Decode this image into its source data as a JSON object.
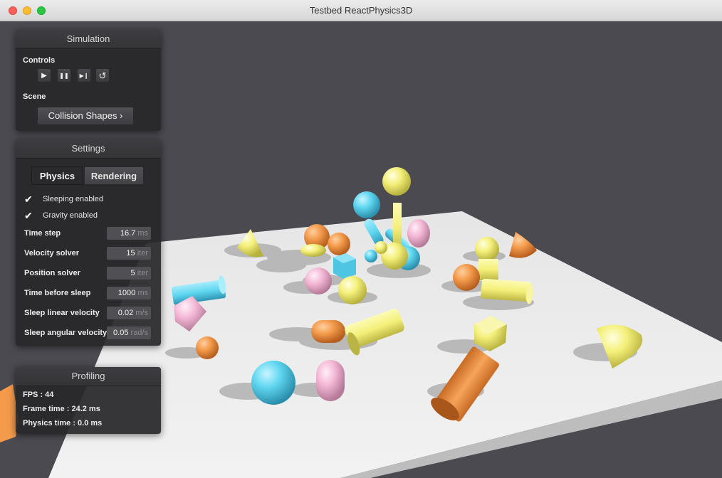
{
  "window": {
    "title": "Testbed ReactPhysics3D"
  },
  "simulation": {
    "header": "Simulation",
    "controls_label": "Controls",
    "buttons": [
      {
        "icon": "play-icon",
        "glyph": "▶"
      },
      {
        "icon": "pause-icon",
        "glyph": "❚❚"
      },
      {
        "icon": "step-icon",
        "glyph": "▶❙"
      },
      {
        "icon": "restart-icon",
        "glyph": "↺"
      }
    ],
    "scene_label": "Scene",
    "scene_button": "Collision Shapes ›"
  },
  "settings": {
    "header": "Settings",
    "tabs": {
      "physics": "Physics",
      "rendering": "Rendering"
    },
    "sleeping": "Sleeping enabled",
    "gravity": "Gravity enabled",
    "check_glyph": "✔",
    "rows": [
      {
        "label": "Time step",
        "value": "16.7",
        "unit": "ms"
      },
      {
        "label": "Velocity solver",
        "value": "15",
        "unit": "iter"
      },
      {
        "label": "Position solver",
        "value": "5",
        "unit": "iter"
      },
      {
        "label": "Time before sleep",
        "value": "1000",
        "unit": "ms"
      },
      {
        "label": "Sleep linear velocity",
        "value": "0.02",
        "unit": "m/s"
      },
      {
        "label": "Sleep angular velocity",
        "value": "0.05",
        "unit": "rad/s"
      }
    ]
  },
  "profiling": {
    "header": "Profiling",
    "fps": "FPS : 44",
    "frame_time": "Frame time : 24.2 ms",
    "physics_time": "Physics time : 0.0 ms"
  },
  "colors": {
    "background": "#4a4a50",
    "floor": "#ececec",
    "orange": "#f39a4b",
    "yellow": "#f4f07a",
    "cyan": "#5fd6f0",
    "pink": "#f4b8d6"
  }
}
